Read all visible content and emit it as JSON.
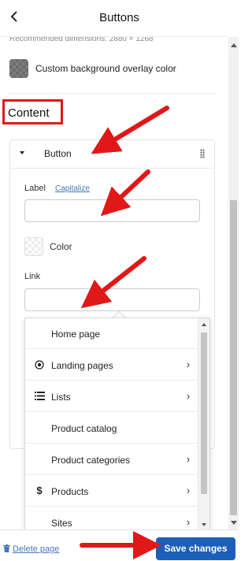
{
  "header": {
    "title": "Buttons",
    "back_icon": "chevron-left-icon"
  },
  "background_settings": {
    "dimensions_hint": "Recommended dimensions: 2880 × 1268",
    "overlay_color_label": "Custom background overlay color",
    "overlay_color_swatch": "#6e6e6e"
  },
  "content_section": {
    "title": "Content",
    "button_block": {
      "title": "Button",
      "label_field": {
        "label": "Label",
        "capitalize_link": "Capitalize",
        "value": ""
      },
      "color_label": "Color",
      "link_field": {
        "label": "Link",
        "value": ""
      }
    }
  },
  "link_dropdown": {
    "items": [
      {
        "label": "Home page",
        "icon": "",
        "has_submenu": false
      },
      {
        "label": "Landing pages",
        "icon": "target-icon",
        "has_submenu": true
      },
      {
        "label": "Lists",
        "icon": "list-icon",
        "has_submenu": true
      },
      {
        "label": "Product catalog",
        "icon": "",
        "has_submenu": false
      },
      {
        "label": "Product categories",
        "icon": "",
        "has_submenu": true
      },
      {
        "label": "Products",
        "icon": "dollar-icon",
        "has_submenu": true
      },
      {
        "label": "Sites",
        "icon": "",
        "has_submenu": true
      }
    ]
  },
  "footer": {
    "delete_label": "Delete page",
    "save_label": "Save changes"
  },
  "colors": {
    "primary_button": "#1c5fb8",
    "link": "#4a76b8",
    "annotation_red": "#e01818"
  }
}
